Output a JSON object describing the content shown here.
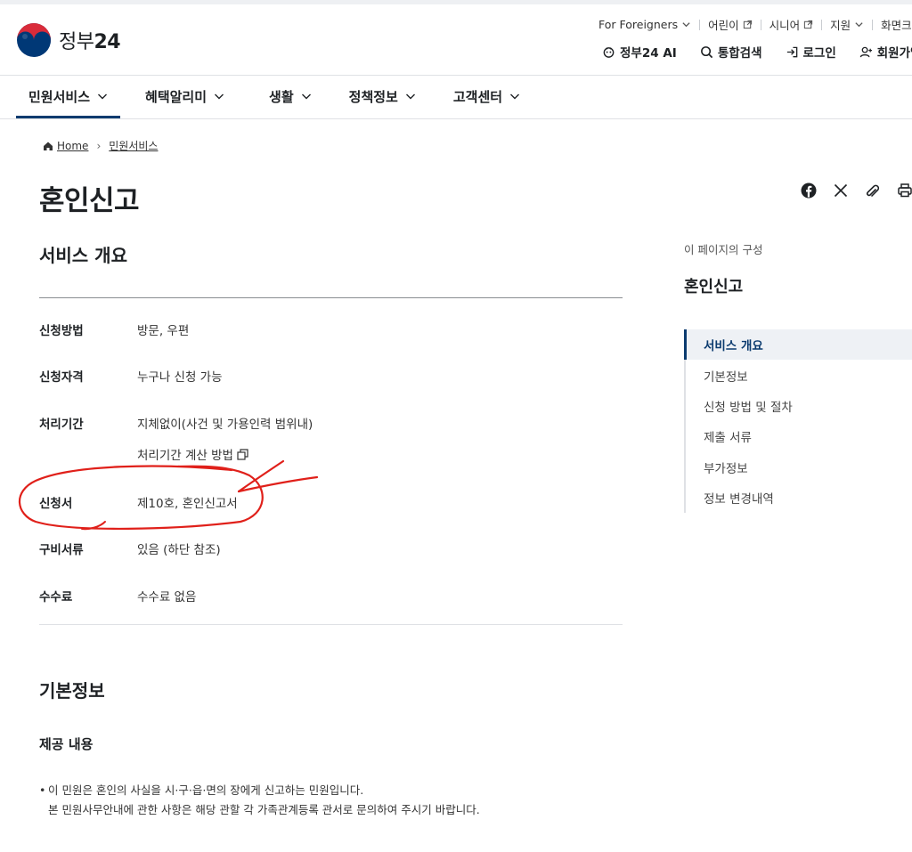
{
  "header": {
    "logo_text": "정부",
    "logo_num": "24",
    "util_links": [
      {
        "label": "For Foreigners",
        "icon": "chevron-down-icon"
      },
      {
        "label": "어린이",
        "icon": "external-link-icon"
      },
      {
        "label": "시니어",
        "icon": "external-link-icon"
      },
      {
        "label": "지원",
        "icon": "chevron-down-icon"
      },
      {
        "label": "화면크기"
      }
    ],
    "gnb": [
      {
        "label": "정부24 AI",
        "icon": "ai-icon"
      },
      {
        "label": "통합검색",
        "icon": "search-icon"
      },
      {
        "label": "로그인",
        "icon": "login-icon"
      },
      {
        "label": "회원가입",
        "icon": "user-add-icon"
      }
    ]
  },
  "main_nav": [
    {
      "label": "민원서비스"
    },
    {
      "label": "혜택알리미"
    },
    {
      "label": "생활"
    },
    {
      "label": "정책정보"
    },
    {
      "label": "고객센터"
    }
  ],
  "breadcrumb": {
    "home": "Home",
    "current": "민원서비스"
  },
  "page_title": "혼인신고",
  "overview": {
    "title": "서비스 개요",
    "rows": [
      {
        "label": "신청방법",
        "value": "방문, 우편"
      },
      {
        "label": "신청자격",
        "value": "누구나 신청 가능"
      },
      {
        "label": "처리기간",
        "value": "지체없이(사건 및 가용인력 범위내)"
      },
      {
        "label": "신청서",
        "value": "제10호, 혼인신고서"
      },
      {
        "label": "구비서류",
        "value": "있음 (하단 참조)"
      },
      {
        "label": "수수료",
        "value": "수수료 없음"
      }
    ],
    "calc_link": "처리기간 계산 방법"
  },
  "basic_info": {
    "title": "기본정보",
    "sub_title": "제공 내용",
    "bullet": "•",
    "line1": "이 민원은 혼인의 사실을 시·구·읍·면의 장에게 신고하는 민원입니다.",
    "line2": "본 민원사무안내에 관한 사항은 해당 관할 각 가족관계등록 관서로 문의하여 주시기 바랍니다."
  },
  "toc": {
    "caption": "이 페이지의 구성",
    "title": "혼인신고",
    "items": [
      {
        "label": "서비스 개요"
      },
      {
        "label": "기본정보"
      },
      {
        "label": "신청 방법 및 절차"
      },
      {
        "label": "제출 서류"
      },
      {
        "label": "부가정보"
      },
      {
        "label": "정보 변경내역"
      }
    ]
  },
  "colors": {
    "accent": "#0b3b6f",
    "annotation": "#e0201a",
    "emblem_red": "#d92b3a",
    "emblem_blue": "#003876"
  }
}
